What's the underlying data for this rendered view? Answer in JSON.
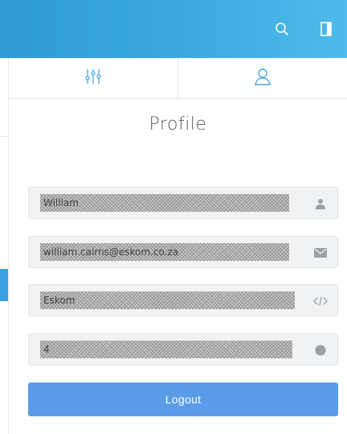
{
  "header": {
    "search_icon": "search-icon",
    "panel_icon": "panel-toggle-icon",
    "gradient": [
      "#2e9bd7",
      "#4dbbea"
    ]
  },
  "tabs": [
    {
      "icon": "sliders-icon",
      "active": false
    },
    {
      "icon": "user-icon",
      "active": true
    }
  ],
  "profile": {
    "title": "Profile",
    "fields": [
      {
        "value": "William",
        "icon": "user-solid-icon"
      },
      {
        "value": "william.cairns@eskom.co.za",
        "icon": "envelope-icon"
      },
      {
        "value": "Eskom",
        "icon": "code-icon"
      },
      {
        "value": "4",
        "icon": "circle-icon"
      }
    ],
    "logout_label": "Logout"
  },
  "colors": {
    "accent": "#3aa0e0",
    "button": "#5b9ce8",
    "icon_muted": "#9aa0a6"
  }
}
